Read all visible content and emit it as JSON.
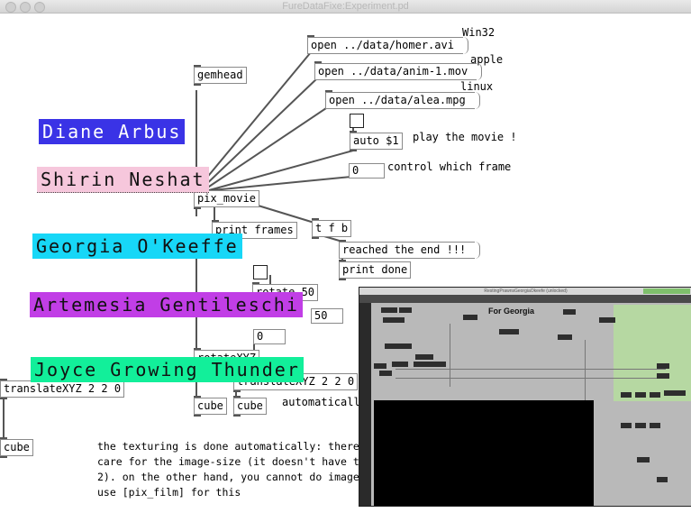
{
  "window": {
    "title": "FureDataFixe:Experiment.pd"
  },
  "patch": {
    "gemhead": "gemhead",
    "msg_win": "open ../data/homer.avi",
    "msg_apple": "open ../data/anim-1.mov",
    "msg_linux": "open ../data/alea.mpg",
    "msg_auto": "auto $1",
    "pix_movie": "pix_movie",
    "print_frames": "print frames",
    "tfb": "t f b",
    "msg_reached": "reached the end !!!",
    "print_done": "print done",
    "num_frame": "0",
    "num_zero": "0",
    "num_50": "50",
    "translate_left": "translateXYZ 2 2 0",
    "translate_mid_partial": "translateXYZ 2 2 0",
    "cube1": "cube",
    "cube2": "cube",
    "cube3": "cube",
    "obj_rotate_partial": "rotate 50",
    "obj_xyz_partial": "rotateXYZ"
  },
  "comments": {
    "win": "Win32",
    "apple": "apple",
    "linux": "linux",
    "play": "play the movie !",
    "control": "control which frame",
    "auto_tail": "automatically",
    "para": "the texturing is done automatically: there\ncare for the image-size (it doesn't have to\n2). on the other hand, you cannot do image-\nuse [pix_film] for this"
  },
  "labels": [
    {
      "text": "Diane Arbus",
      "bg": "#3a33e6",
      "fg": "#ffffff"
    },
    {
      "text": "Shirin Neshat",
      "bg": "#f6c7dc",
      "fg": "#111111"
    },
    {
      "text": "Georgia O'Keeffe",
      "bg": "#17d7f7",
      "fg": "#111111"
    },
    {
      "text": "Artemesia Gentileschi",
      "bg": "#c13ee6",
      "fg": "#111111"
    },
    {
      "text": "Joyce Growing Thunder",
      "bg": "#12ef9a",
      "fg": "#111111"
    }
  ],
  "inset": {
    "title": "RestingPrawnsGeorgiaOkeefe (unlocked)",
    "heading": "For Georgia"
  }
}
